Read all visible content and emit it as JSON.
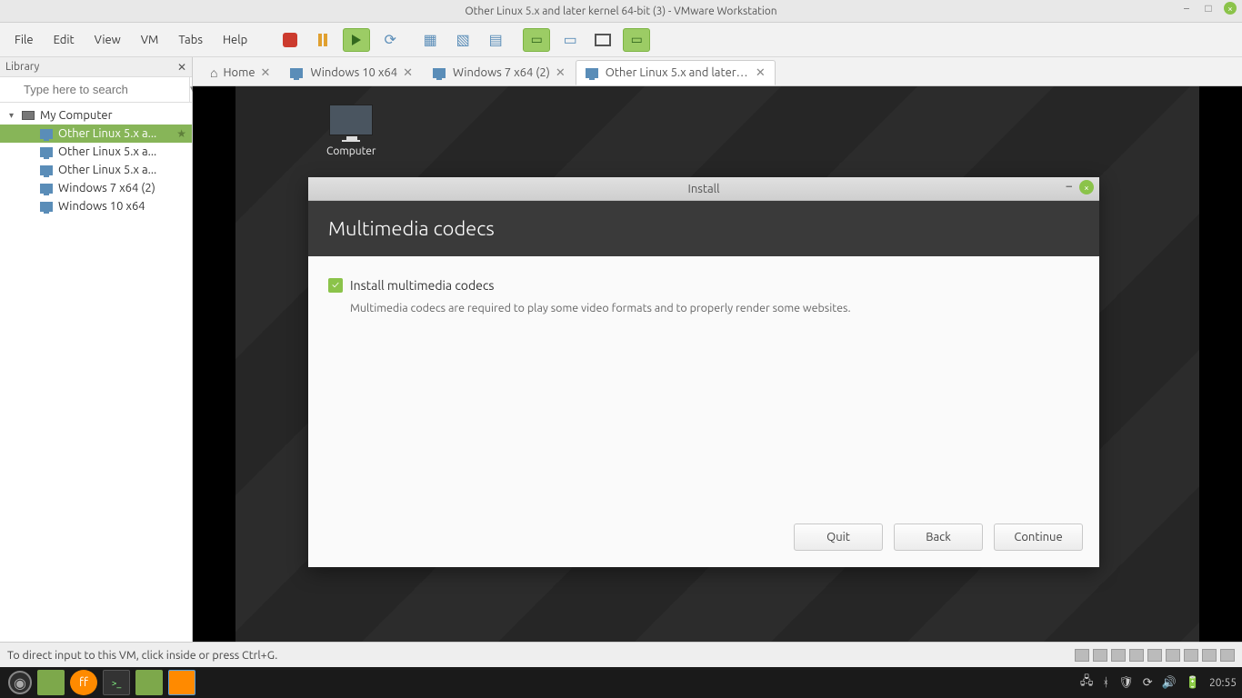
{
  "window": {
    "title": "Other Linux 5.x and later kernel 64-bit (3) - VMware Workstation"
  },
  "menus": [
    "File",
    "Edit",
    "View",
    "VM",
    "Tabs",
    "Help"
  ],
  "library": {
    "title": "Library",
    "search_placeholder": "Type here to search",
    "root": "My Computer",
    "items": [
      {
        "label": "Other Linux 5.x a...",
        "selected": true
      },
      {
        "label": "Other Linux 5.x a..."
      },
      {
        "label": "Other Linux 5.x a..."
      },
      {
        "label": "Windows 7 x64 (2)"
      },
      {
        "label": "Windows 10 x64"
      }
    ]
  },
  "tabs": [
    {
      "label": "Home",
      "kind": "home"
    },
    {
      "label": "Windows 10 x64",
      "kind": "vm"
    },
    {
      "label": "Windows 7 x64 (2)",
      "kind": "vm"
    },
    {
      "label": "Other Linux 5.x and later kerne...",
      "kind": "vm",
      "active": true
    }
  ],
  "guest": {
    "desktop_icon": "Computer",
    "installer": {
      "window_title": "Install",
      "heading": "Multimedia codecs",
      "checkbox_label": "Install multimedia codecs",
      "checkbox_checked": true,
      "description": "Multimedia codecs are required to play some video formats and to properly render some websites.",
      "buttons": {
        "quit": "Quit",
        "back": "Back",
        "continue": "Continue"
      }
    }
  },
  "statusbar": {
    "hint": "To direct input to this VM, click inside or press Ctrl+G."
  },
  "hostbar": {
    "clock": "20:55"
  }
}
